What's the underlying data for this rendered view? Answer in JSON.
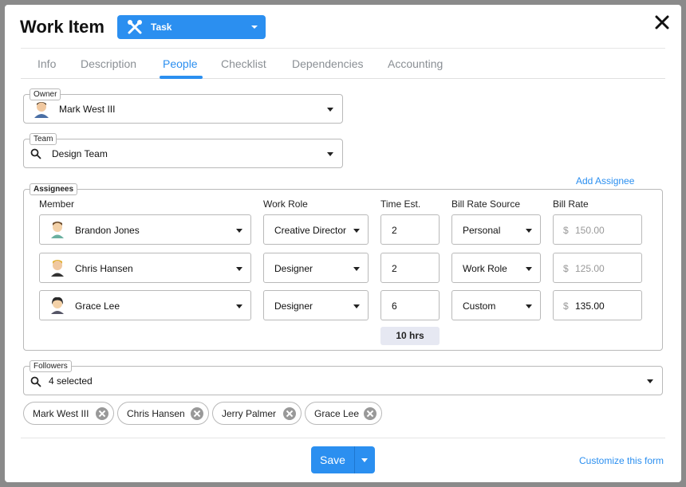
{
  "header": {
    "title": "Work Item",
    "type_label": "Task",
    "close_icon": "close-icon"
  },
  "tabs": [
    {
      "label": "Info"
    },
    {
      "label": "Description"
    },
    {
      "label": "People",
      "active": true
    },
    {
      "label": "Checklist"
    },
    {
      "label": "Dependencies"
    },
    {
      "label": "Accounting"
    }
  ],
  "owner": {
    "legend": "Owner",
    "value": "Mark West III"
  },
  "team": {
    "legend": "Team",
    "value": "Design Team"
  },
  "assignees": {
    "legend": "Assignees",
    "add_label": "Add Assignee",
    "columns": [
      "Member",
      "Work Role",
      "Time Est.",
      "Bill Rate Source",
      "Bill Rate"
    ],
    "rows": [
      {
        "member": "Brandon Jones",
        "role": "Creative Director",
        "time": "2",
        "source": "Personal",
        "rate": "150.00"
      },
      {
        "member": "Chris Hansen",
        "role": "Designer",
        "time": "2",
        "source": "Work Role",
        "rate": "125.00"
      },
      {
        "member": "Grace Lee",
        "role": "Designer",
        "time": "6",
        "source": "Custom",
        "rate": "135.00"
      }
    ],
    "currency": "$",
    "total": "10 hrs"
  },
  "followers": {
    "legend": "Followers",
    "value": "4 selected",
    "chips": [
      "Mark West III",
      "Chris Hansen",
      "Jerry Palmer",
      "Grace Lee"
    ]
  },
  "footer": {
    "save_label": "Save",
    "customize_label": "Customize this form"
  },
  "colors": {
    "accent": "#2b8ff0"
  }
}
